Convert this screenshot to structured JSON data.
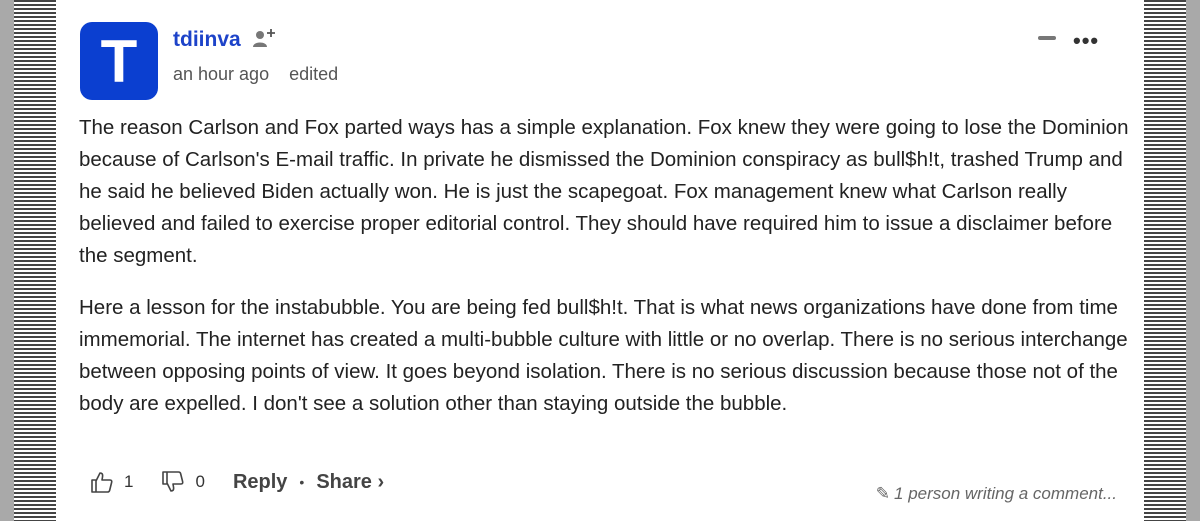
{
  "comment": {
    "avatar_letter": "T",
    "avatar_color": "#0b3fd0",
    "username": "tdiinva",
    "timestamp": "an hour ago",
    "edited_label": "edited",
    "paragraphs": [
      "The reason Carlson and Fox parted ways has a simple explanation. Fox knew they were going to lose the Dominion because of Carlson's E-mail traffic. In private he dismissed the Dominion conspiracy as bull$h!t, trashed Trump and he said he believed Biden actually won. He is just the scapegoat. Fox management knew what Carlson really believed and failed to exercise proper editorial control. They should have required him to issue a disclaimer before the segment.",
      "Here a lesson for the instabubble. You are being fed bull$h!t. That is what news organizations have done from time immemorial. The internet has created a multi-bubble culture with little or no overlap. There is no serious interchange between opposing points of view. It goes beyond isolation. There is no serious discussion because those not of the body are expelled. I don't see a solution other than staying outside the bubble."
    ]
  },
  "actions": {
    "like_count": "1",
    "dislike_count": "0",
    "reply_label": "Reply",
    "share_label": "Share ›",
    "separator": "•"
  },
  "status": {
    "writing_text": "1 person writing a comment..."
  },
  "icons": {
    "follow": "add-user-icon",
    "more": "more-options-icon",
    "minimize": "minimize-icon",
    "like": "thumbs-up-icon",
    "dislike": "thumbs-down-icon",
    "writing": "pencil-icon"
  }
}
